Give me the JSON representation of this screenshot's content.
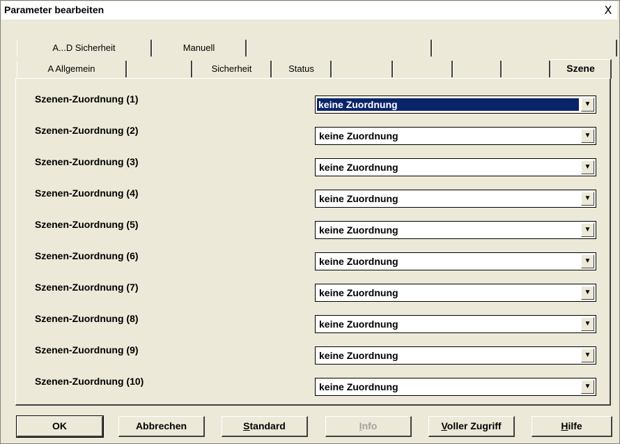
{
  "window": {
    "title": "Parameter bearbeiten",
    "close_glyph": "X"
  },
  "tabs_row1": [
    {
      "label": "A...D  Sicherheit"
    },
    {
      "label": "Manuell"
    },
    {
      "label": ""
    },
    {
      "label": ""
    }
  ],
  "tabs_row2": [
    {
      "label": "A  Allgemein"
    },
    {
      "label": ""
    },
    {
      "label": "Sicherheit"
    },
    {
      "label": "Status"
    },
    {
      "label": ""
    },
    {
      "label": ""
    },
    {
      "label": ""
    },
    {
      "label": ""
    },
    {
      "label": "Szene",
      "active": true
    }
  ],
  "rows": [
    {
      "label": "Szenen-Zuordnung (1)",
      "value": "keine Zuordnung",
      "focused": true
    },
    {
      "label": "Szenen-Zuordnung (2)",
      "value": "keine Zuordnung"
    },
    {
      "label": "Szenen-Zuordnung (3)",
      "value": "keine Zuordnung"
    },
    {
      "label": "Szenen-Zuordnung (4)",
      "value": "keine Zuordnung"
    },
    {
      "label": "Szenen-Zuordnung (5)",
      "value": "keine Zuordnung"
    },
    {
      "label": "Szenen-Zuordnung (6)",
      "value": "keine Zuordnung"
    },
    {
      "label": "Szenen-Zuordnung (7)",
      "value": "keine Zuordnung"
    },
    {
      "label": "Szenen-Zuordnung (8)",
      "value": "keine Zuordnung"
    },
    {
      "label": "Szenen-Zuordnung (9)",
      "value": "keine Zuordnung"
    },
    {
      "label": "Szenen-Zuordnung (10)",
      "value": "keine Zuordnung"
    }
  ],
  "buttons": {
    "ok": "OK",
    "cancel": "Abbrechen",
    "standard_u": "S",
    "standard_rest": "tandard",
    "info_u": "I",
    "info_rest": "nfo",
    "full_access_u": "V",
    "full_access_rest": "oller Zugriff",
    "help_u": "H",
    "help_rest": "ilfe"
  },
  "icons": {
    "dropdown_arrow": "chevron-down-icon",
    "close": "close-icon"
  },
  "colors": {
    "selection": "#0a246a",
    "dialog_bg": "#ece9d8"
  }
}
